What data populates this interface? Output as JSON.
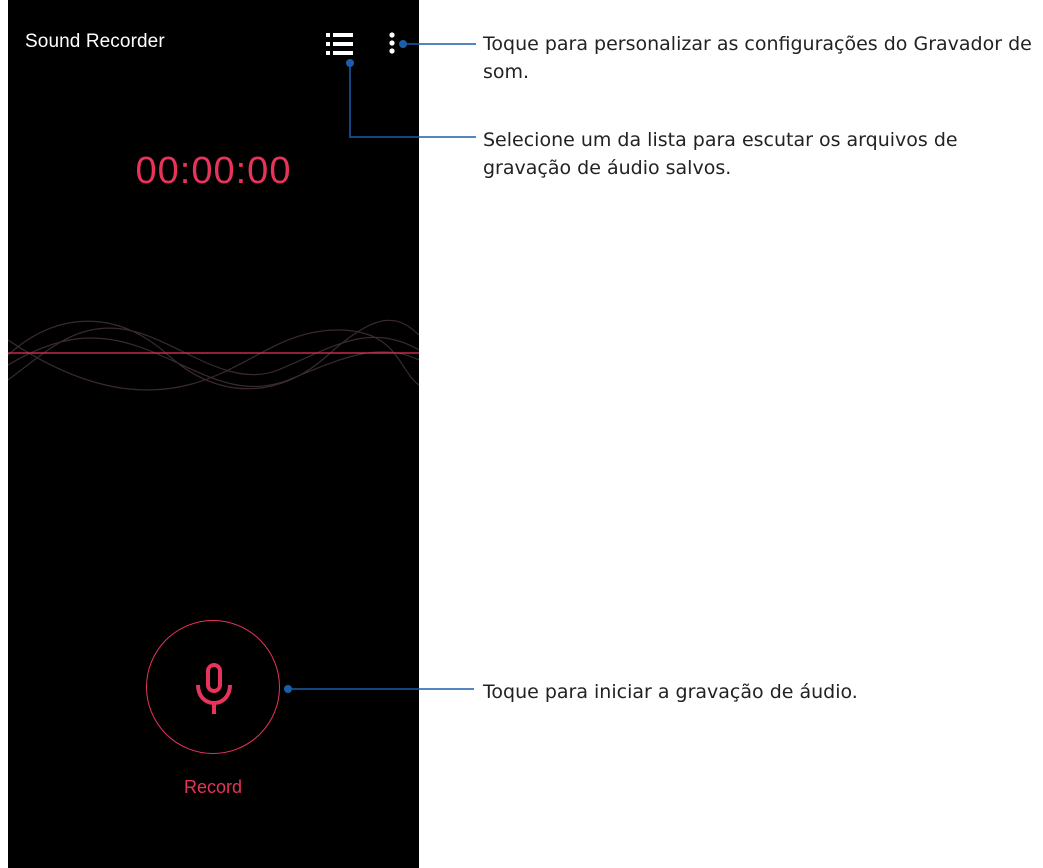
{
  "app": {
    "title": "Sound Recorder",
    "timer": "00:00:00",
    "record_label": "Record"
  },
  "icons": {
    "list": "list-icon",
    "more": "more-vertical-icon",
    "mic": "microphone-icon"
  },
  "colors": {
    "screen_background": "#000000",
    "accent": "#e8335a",
    "callout_line": "#1a5fa8",
    "callout_text": "#222222"
  },
  "callouts": {
    "settings": "Toque para personalizar as configurações do Gravador de som.",
    "recordings_list": "Selecione um da lista para escutar os arquivos de gravação de áudio salvos.",
    "record": "Toque para iniciar a gravação de áudio."
  }
}
